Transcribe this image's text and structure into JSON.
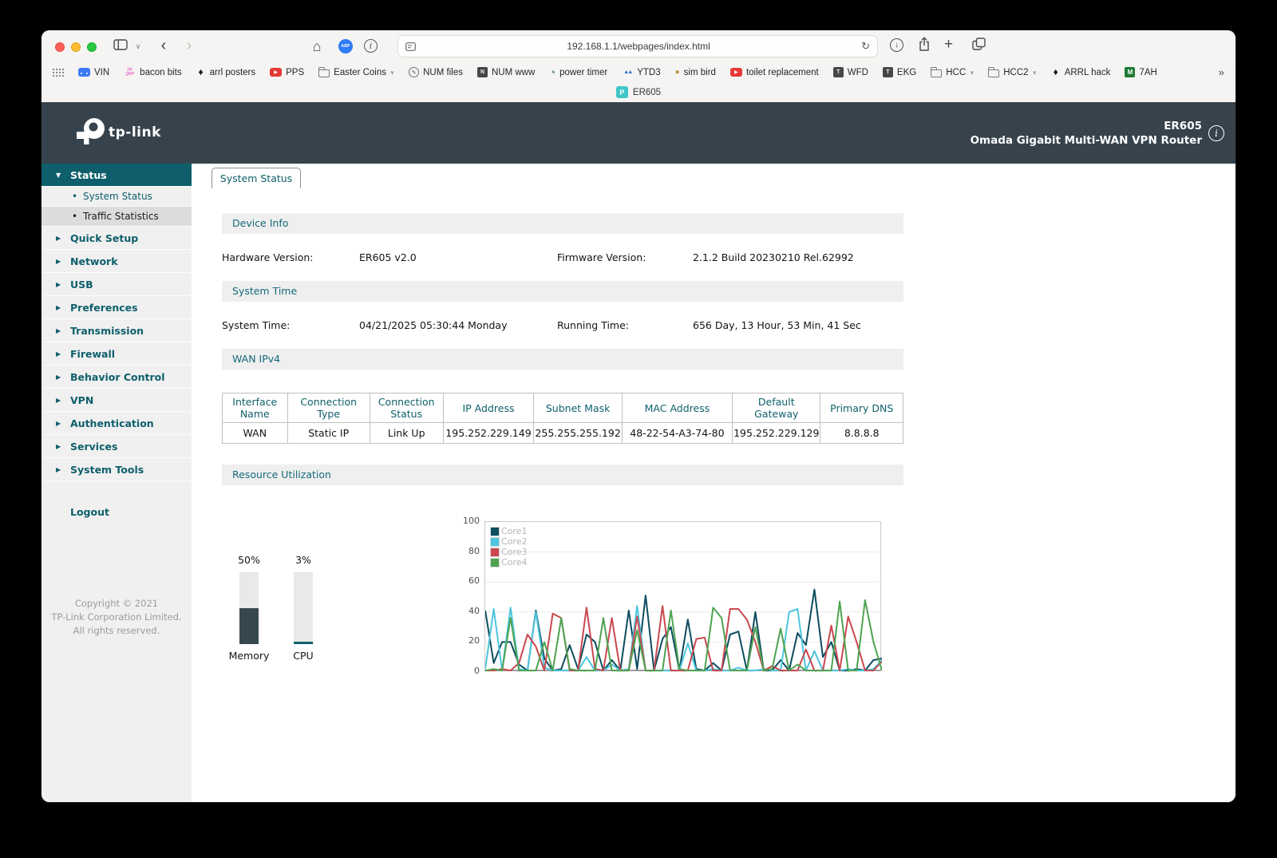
{
  "browser": {
    "url": "192.168.1.1/webpages/index.html",
    "abp_label": "ABP",
    "overflow": "»",
    "active_tab": {
      "favicon_letter": "P",
      "title": "ER605"
    },
    "bookmarks": [
      {
        "type": "apps-grid",
        "label": ""
      },
      {
        "type": "car",
        "label": "VIN"
      },
      {
        "type": "fpqrp",
        "label": "bacon bits",
        "glyph": "FP\nQRP"
      },
      {
        "type": "diamond",
        "label": "arrl posters",
        "glyph": "♦"
      },
      {
        "type": "youtube",
        "label": "PPS",
        "glyph": "▶"
      },
      {
        "type": "folder",
        "label": "Easter Coins",
        "chevron": "∨"
      },
      {
        "type": "pencil",
        "label": "NUM files",
        "glyph": "✎"
      },
      {
        "type": "thumb",
        "label": "NUM www",
        "glyph": "N"
      },
      {
        "type": "globe",
        "label": "power timer",
        "glyph": "◔"
      },
      {
        "type": "mountains",
        "label": "YTD3",
        "glyph": "▲▲"
      },
      {
        "type": "bird",
        "label": "sim bird",
        "glyph": "●"
      },
      {
        "type": "youtube",
        "label": "toilet replacement",
        "glyph": "▶"
      },
      {
        "type": "thumb",
        "label": "WFD",
        "glyph": "T"
      },
      {
        "type": "thumb",
        "label": "EKG",
        "glyph": "T"
      },
      {
        "type": "folder",
        "label": "HCC",
        "chevron": "∨"
      },
      {
        "type": "folder",
        "label": "HCC2",
        "chevron": "∨"
      },
      {
        "type": "diamond",
        "label": "ARRL hack",
        "glyph": "♦"
      },
      {
        "type": "m-badge",
        "label": "7AH",
        "glyph": "M"
      }
    ]
  },
  "header": {
    "brand": "tp-link",
    "model": "ER605",
    "subtitle": "Omada Gigabit Multi-WAN VPN Router"
  },
  "sidebar": {
    "items": [
      {
        "label": "Status",
        "kind": "group",
        "expanded": true,
        "selected": true
      },
      {
        "label": "System Status",
        "kind": "sub",
        "active": true
      },
      {
        "label": "Traffic Statistics",
        "kind": "sub",
        "highlighted": true
      },
      {
        "label": "Quick Setup",
        "kind": "group"
      },
      {
        "label": "Network",
        "kind": "group"
      },
      {
        "label": "USB",
        "kind": "group"
      },
      {
        "label": "Preferences",
        "kind": "group"
      },
      {
        "label": "Transmission",
        "kind": "group"
      },
      {
        "label": "Firewall",
        "kind": "group"
      },
      {
        "label": "Behavior Control",
        "kind": "group"
      },
      {
        "label": "VPN",
        "kind": "group"
      },
      {
        "label": "Authentication",
        "kind": "group"
      },
      {
        "label": "Services",
        "kind": "group"
      },
      {
        "label": "System Tools",
        "kind": "group"
      }
    ],
    "logout": "Logout",
    "copyright": [
      "Copyright © 2021",
      "TP-Link Corporation Limited.",
      "All rights reserved."
    ]
  },
  "main": {
    "tab": "System Status",
    "device_info": {
      "title": "Device Info",
      "fields": [
        {
          "label": "Hardware Version:",
          "value": "ER605 v2.0"
        },
        {
          "label": "Firmware Version:",
          "value": "2.1.2 Build 20230210 Rel.62992"
        }
      ]
    },
    "system_time": {
      "title": "System Time",
      "fields": [
        {
          "label": "System Time:",
          "value": "04/21/2025 05:30:44 Monday"
        },
        {
          "label": "Running Time:",
          "value": "656 Day, 13 Hour, 53 Min, 41 Sec"
        }
      ]
    },
    "wan": {
      "title": "WAN IPv4",
      "columns": [
        "Interface Name",
        "Connection Type",
        "Connection Status",
        "IP Address",
        "Subnet Mask",
        "MAC Address",
        "Default Gateway",
        "Primary DNS"
      ],
      "rows": [
        [
          "WAN",
          "Static IP",
          "Link Up",
          "195.252.229.149",
          "255.255.255.192",
          "48-22-54-A3-74-80",
          "195.252.229.129",
          "8.8.8.8"
        ]
      ]
    },
    "resource": {
      "title": "Resource Utilization",
      "gauges": [
        {
          "name": "Memory",
          "percent": 50,
          "label": "50%",
          "color": "#37474F"
        },
        {
          "name": "CPU",
          "percent": 3,
          "label": "3%",
          "color": "#0E5F6B"
        }
      ]
    }
  },
  "chart_data": {
    "type": "line",
    "title": "CPU core utilization",
    "x_count": 48,
    "ylim": [
      0,
      100
    ],
    "yticks": [
      0,
      20,
      40,
      60,
      80,
      100
    ],
    "grid": true,
    "legend_position": "top-left",
    "series": [
      {
        "name": "Core1",
        "color": "#0D4D5F",
        "values": [
          41,
          6,
          20,
          20,
          5,
          1,
          41,
          9,
          1,
          2,
          18,
          2,
          25,
          20,
          1,
          8,
          1,
          41,
          2,
          51,
          1,
          22,
          30,
          1,
          35,
          2,
          1,
          6,
          1,
          25,
          27,
          1,
          40,
          1,
          1,
          8,
          1,
          26,
          18,
          55,
          10,
          20,
          1,
          1,
          2,
          1,
          8,
          9
        ]
      },
      {
        "name": "Core2",
        "color": "#4EC5DE",
        "values": [
          2,
          42,
          1,
          43,
          2,
          1,
          40,
          3,
          1,
          1,
          1,
          1,
          10,
          1,
          1,
          5,
          1,
          2,
          44,
          1,
          1,
          1,
          1,
          1,
          19,
          1,
          1,
          2,
          1,
          1,
          3,
          1,
          1,
          2,
          1,
          1,
          40,
          42,
          1,
          14,
          1,
          1,
          1,
          2,
          1,
          1,
          2,
          8
        ]
      },
      {
        "name": "Core3",
        "color": "#C9474F",
        "values": [
          1,
          1,
          2,
          1,
          6,
          25,
          17,
          1,
          39,
          36,
          1,
          1,
          43,
          2,
          1,
          36,
          1,
          1,
          37,
          1,
          1,
          44,
          1,
          1,
          1,
          22,
          23,
          1,
          1,
          42,
          42,
          35,
          20,
          1,
          4,
          1,
          1,
          1,
          15,
          1,
          1,
          31,
          1,
          37,
          20,
          1,
          1,
          7
        ]
      },
      {
        "name": "Core4",
        "color": "#4EA351",
        "values": [
          1,
          2,
          1,
          36,
          1,
          1,
          1,
          20,
          1,
          36,
          2,
          1,
          1,
          1,
          36,
          1,
          1,
          1,
          28,
          1,
          1,
          1,
          41,
          2,
          1,
          1,
          1,
          43,
          36,
          1,
          1,
          1,
          30,
          1,
          2,
          29,
          1,
          5,
          1,
          1,
          1,
          1,
          47,
          1,
          1,
          48,
          20,
          1
        ]
      }
    ]
  }
}
